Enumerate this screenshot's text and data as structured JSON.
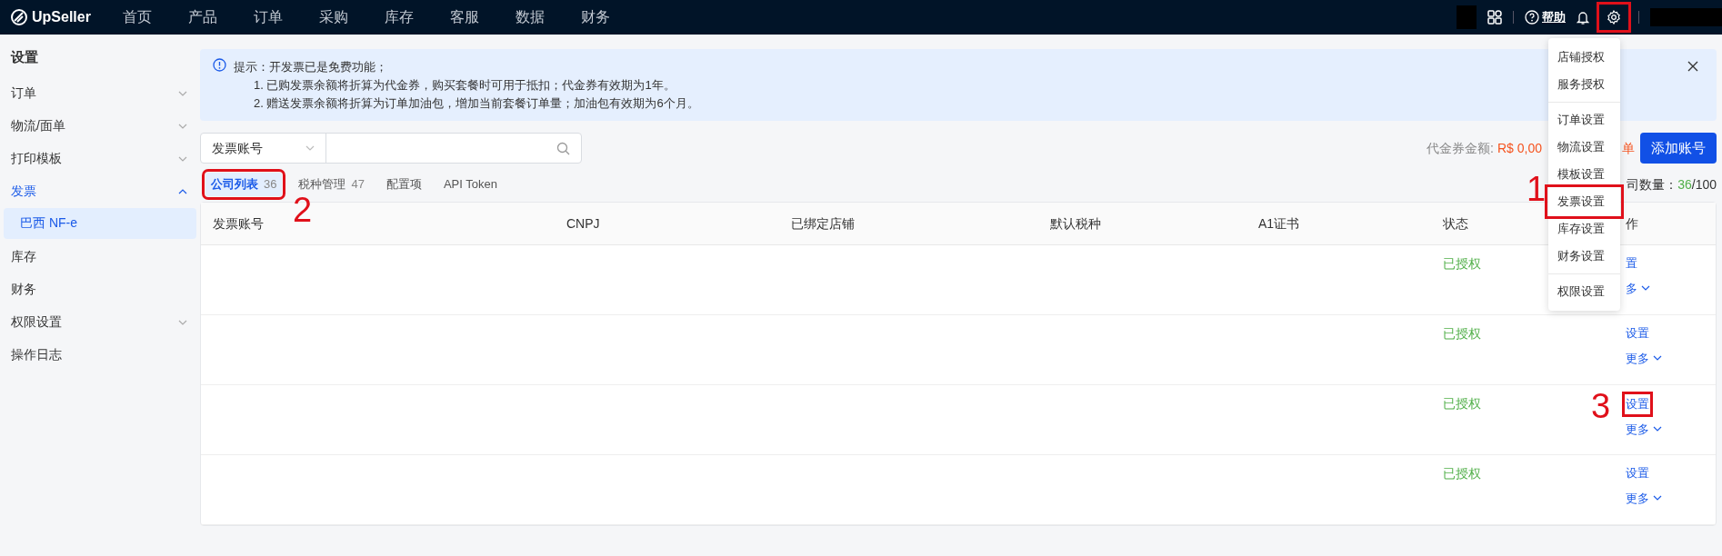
{
  "topbar": {
    "logo": "UpSeller",
    "nav": [
      {
        "label": "首页"
      },
      {
        "label": "产品"
      },
      {
        "label": "订单"
      },
      {
        "label": "采购"
      },
      {
        "label": "库存"
      },
      {
        "label": "客服"
      },
      {
        "label": "数据"
      },
      {
        "label": "财务"
      }
    ],
    "help": "帮助",
    "settings_highlighted": true
  },
  "sidebar": {
    "title": "设置",
    "items": [
      {
        "label": "订单",
        "expandable": true,
        "expanded": false
      },
      {
        "label": "物流/面单",
        "expandable": true,
        "expanded": false
      },
      {
        "label": "打印模板",
        "expandable": true,
        "expanded": false
      },
      {
        "label": "发票",
        "expandable": true,
        "expanded": true,
        "children": [
          {
            "label": "巴西 NF-e",
            "selected": true
          }
        ]
      },
      {
        "label": "库存",
        "expandable": false
      },
      {
        "label": "财务",
        "expandable": false
      },
      {
        "label": "权限设置",
        "expandable": true,
        "expanded": false
      },
      {
        "label": "操作日志",
        "expandable": false
      }
    ]
  },
  "notice": {
    "lines": [
      "提示：开发票已是免费功能；",
      "1. 已购发票余额将折算为代金券，购买套餐时可用于抵扣；代金券有效期为1年。",
      "2. 赠送发票余额将折算为订单加油包，增加当前套餐订单量；加油包有效期为6个月。"
    ]
  },
  "search": {
    "field_select": "发票账号"
  },
  "voucher": {
    "label": "代金券金额:",
    "amount": "R$ 0,00",
    "link_visible": "单"
  },
  "add_button": "添加账号",
  "tabs": [
    {
      "label": "公司列表",
      "count": "36",
      "selected": true,
      "highlighted": true,
      "callout": "2"
    },
    {
      "label": "税种管理",
      "count": "47",
      "selected": false
    },
    {
      "label": "配置项",
      "selected": false
    },
    {
      "label": "API Token",
      "selected": false
    }
  ],
  "company_count": {
    "label": "司数量：",
    "used": "36",
    "total": "/100"
  },
  "table": {
    "columns": [
      "发票账号",
      "CNPJ",
      "已绑定店铺",
      "默认税种",
      "A1证书",
      "状态",
      "作"
    ],
    "rows": [
      {
        "status": "已授权",
        "actions": [
          {
            "label": "置",
            "kind": "link"
          },
          {
            "label": "多",
            "kind": "more"
          }
        ]
      },
      {
        "status": "已授权",
        "actions": [
          {
            "label": "设置",
            "kind": "link"
          },
          {
            "label": "更多",
            "kind": "more"
          }
        ]
      },
      {
        "status": "已授权",
        "actions": [
          {
            "label": "设置",
            "kind": "link",
            "highlighted": true,
            "callout": "3"
          },
          {
            "label": "更多",
            "kind": "more"
          }
        ]
      },
      {
        "status": "已授权",
        "actions": [
          {
            "label": "设置",
            "kind": "link"
          },
          {
            "label": "更多",
            "kind": "more"
          }
        ]
      }
    ]
  },
  "settings_menu": {
    "groups": [
      [
        {
          "label": "店铺授权"
        },
        {
          "label": "服务授权"
        }
      ],
      [
        {
          "label": "订单设置"
        },
        {
          "label": "物流设置"
        },
        {
          "label": "模板设置"
        },
        {
          "label": "发票设置",
          "highlighted": true,
          "callout": "1"
        },
        {
          "label": "库存设置"
        },
        {
          "label": "财务设置"
        }
      ],
      [
        {
          "label": "权限设置"
        }
      ]
    ]
  }
}
